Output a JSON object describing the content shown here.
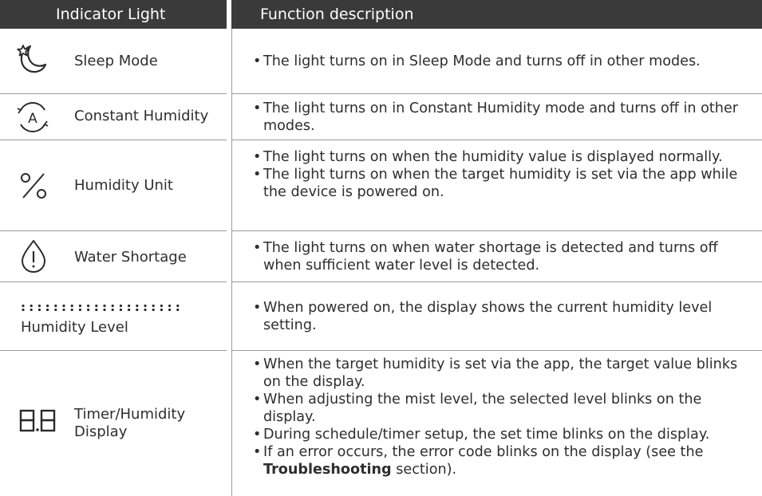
{
  "header": {
    "indicator_light": "Indicator Light",
    "function_description": "Function description"
  },
  "rows": [
    {
      "icon": "sleep-moon-star-icon",
      "label": "Sleep Mode",
      "bullets": [
        "The light turns on in Sleep Mode and turns off in other modes."
      ]
    },
    {
      "icon": "constant-humidity-a-icon",
      "label": "Constant Humidity",
      "bullets": [
        "The light turns on in Constant Humidity mode and turns off in other modes."
      ]
    },
    {
      "icon": "percent-icon",
      "label": "Humidity Unit",
      "bullets": [
        "The light turns on when the humidity value is displayed normally.",
        "The light turns on when the target humidity is set via the app while the device is powered on."
      ]
    },
    {
      "icon": "water-drop-exclamation-icon",
      "label": "Water Shortage",
      "bullets": [
        "The light turns on when water shortage is detected and turns off when sufficient water level is detected."
      ]
    },
    {
      "icon": "humidity-level-dots-icon",
      "label": "Humidity Level",
      "bullets": [
        "When powered on, the display shows the current humidity level setting."
      ]
    },
    {
      "icon": "seven-segment-88-icon",
      "label": "Timer/Humidity Display",
      "bullets": [
        "When the target humidity is set via the app, the target value blinks on the display.",
        "When adjusting the mist level, the selected level blinks on the display.",
        "During schedule/timer setup, the set time blinks on the display."
      ],
      "last_bullet": {
        "before": "If an error occurs, the error code blinks on the display (see the ",
        "bold": "Troubleshooting",
        "after": " section)."
      }
    }
  ]
}
